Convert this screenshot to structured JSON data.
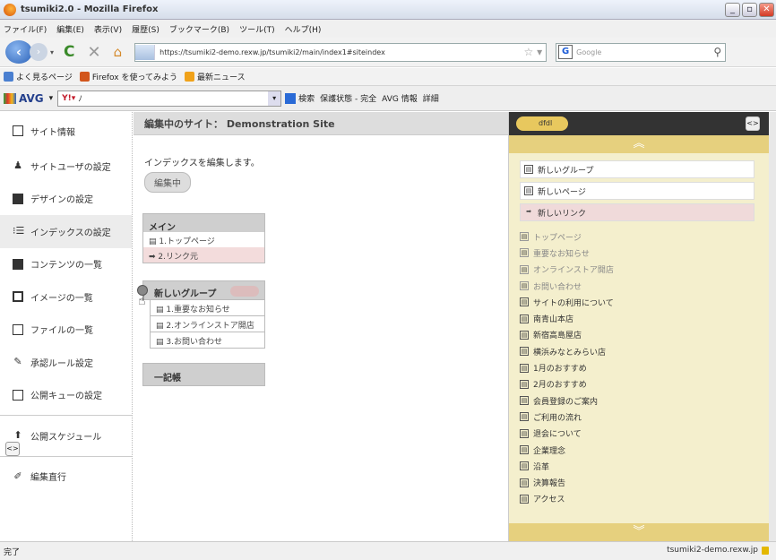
{
  "window": {
    "title": "tsumiki2.0 - Mozilla Firefox"
  },
  "menu": [
    "ファイル(F)",
    "編集(E)",
    "表示(V)",
    "履歴(S)",
    "ブックマーク(B)",
    "ツール(T)",
    "ヘルプ(H)"
  ],
  "nav": {
    "url": "https://tsumiki2-demo.rexw.jp/tsumiki2/main/index1#siteindex",
    "search_placeholder": "Google"
  },
  "bookmarks": [
    "よく見るページ",
    "Firefox を使ってみよう",
    "最新ニュース"
  ],
  "avg": {
    "brand": "AVG",
    "search_text": "ﾉ",
    "search_label": "検索",
    "safety": "保護状態 - 完全",
    "info": "AVG 情報",
    "detail": "詳細"
  },
  "sidebar": {
    "items": [
      {
        "label": "サイト情報",
        "icon": "site-icon"
      },
      {
        "label": "サイトユーザの設定",
        "icon": "user-icon"
      },
      {
        "label": "デザインの設定",
        "icon": "design-icon"
      },
      {
        "label": "インデックスの設定",
        "icon": "index-icon"
      },
      {
        "label": "コンテンツの一覧",
        "icon": "contents-icon"
      },
      {
        "label": "イメージの一覧",
        "icon": "image-icon"
      },
      {
        "label": "ファイルの一覧",
        "icon": "file-icon"
      },
      {
        "label": "承認ルール設定",
        "icon": "approval-icon"
      },
      {
        "label": "公開キューの設定",
        "icon": "queue-icon"
      },
      {
        "label": "公開スケジュール",
        "icon": "schedule-icon"
      },
      {
        "label": "編集直行",
        "icon": "pencil-icon"
      }
    ],
    "toggle": "<>"
  },
  "main": {
    "header": "編集中のサイト： Demonstration Site",
    "intro": "インデックスを編集します。",
    "editing_label": "編集中",
    "main_box": {
      "title": "メイン",
      "rows": [
        "1.トップページ",
        "2.リンク元"
      ]
    },
    "group_box": {
      "title": "新しいグループ",
      "rows": [
        "1.重要なお知らせ",
        "2.オンラインストア開店",
        "3.お問い合わせ"
      ]
    },
    "others_box": {
      "title": "一記帳"
    }
  },
  "rpanel": {
    "pill": "dfdl",
    "toggle": "<>",
    "new_items": [
      "新しいグループ",
      "新しいページ",
      "新しいリンク"
    ],
    "items": [
      {
        "label": "トップページ",
        "faded": true
      },
      {
        "label": "重要なお知らせ",
        "faded": true
      },
      {
        "label": "オンラインストア開店",
        "faded": true
      },
      {
        "label": "お問い合わせ",
        "faded": true
      },
      {
        "label": "サイトの利用について",
        "faded": false
      },
      {
        "label": "南青山本店",
        "faded": false
      },
      {
        "label": "新宿高島屋店",
        "faded": false
      },
      {
        "label": "横浜みなとみらい店",
        "faded": false
      },
      {
        "label": "1月のおすすめ",
        "faded": false
      },
      {
        "label": "2月のおすすめ",
        "faded": false
      },
      {
        "label": "会員登録のご案内",
        "faded": false
      },
      {
        "label": "ご利用の流れ",
        "faded": false
      },
      {
        "label": "退会について",
        "faded": false
      },
      {
        "label": "企業理念",
        "faded": false
      },
      {
        "label": "沿革",
        "faded": false
      },
      {
        "label": "決算報告",
        "faded": false
      },
      {
        "label": "アクセス",
        "faded": false
      }
    ]
  },
  "status": {
    "left": "完了",
    "right": "tsumiki2-demo.rexw.jp"
  }
}
